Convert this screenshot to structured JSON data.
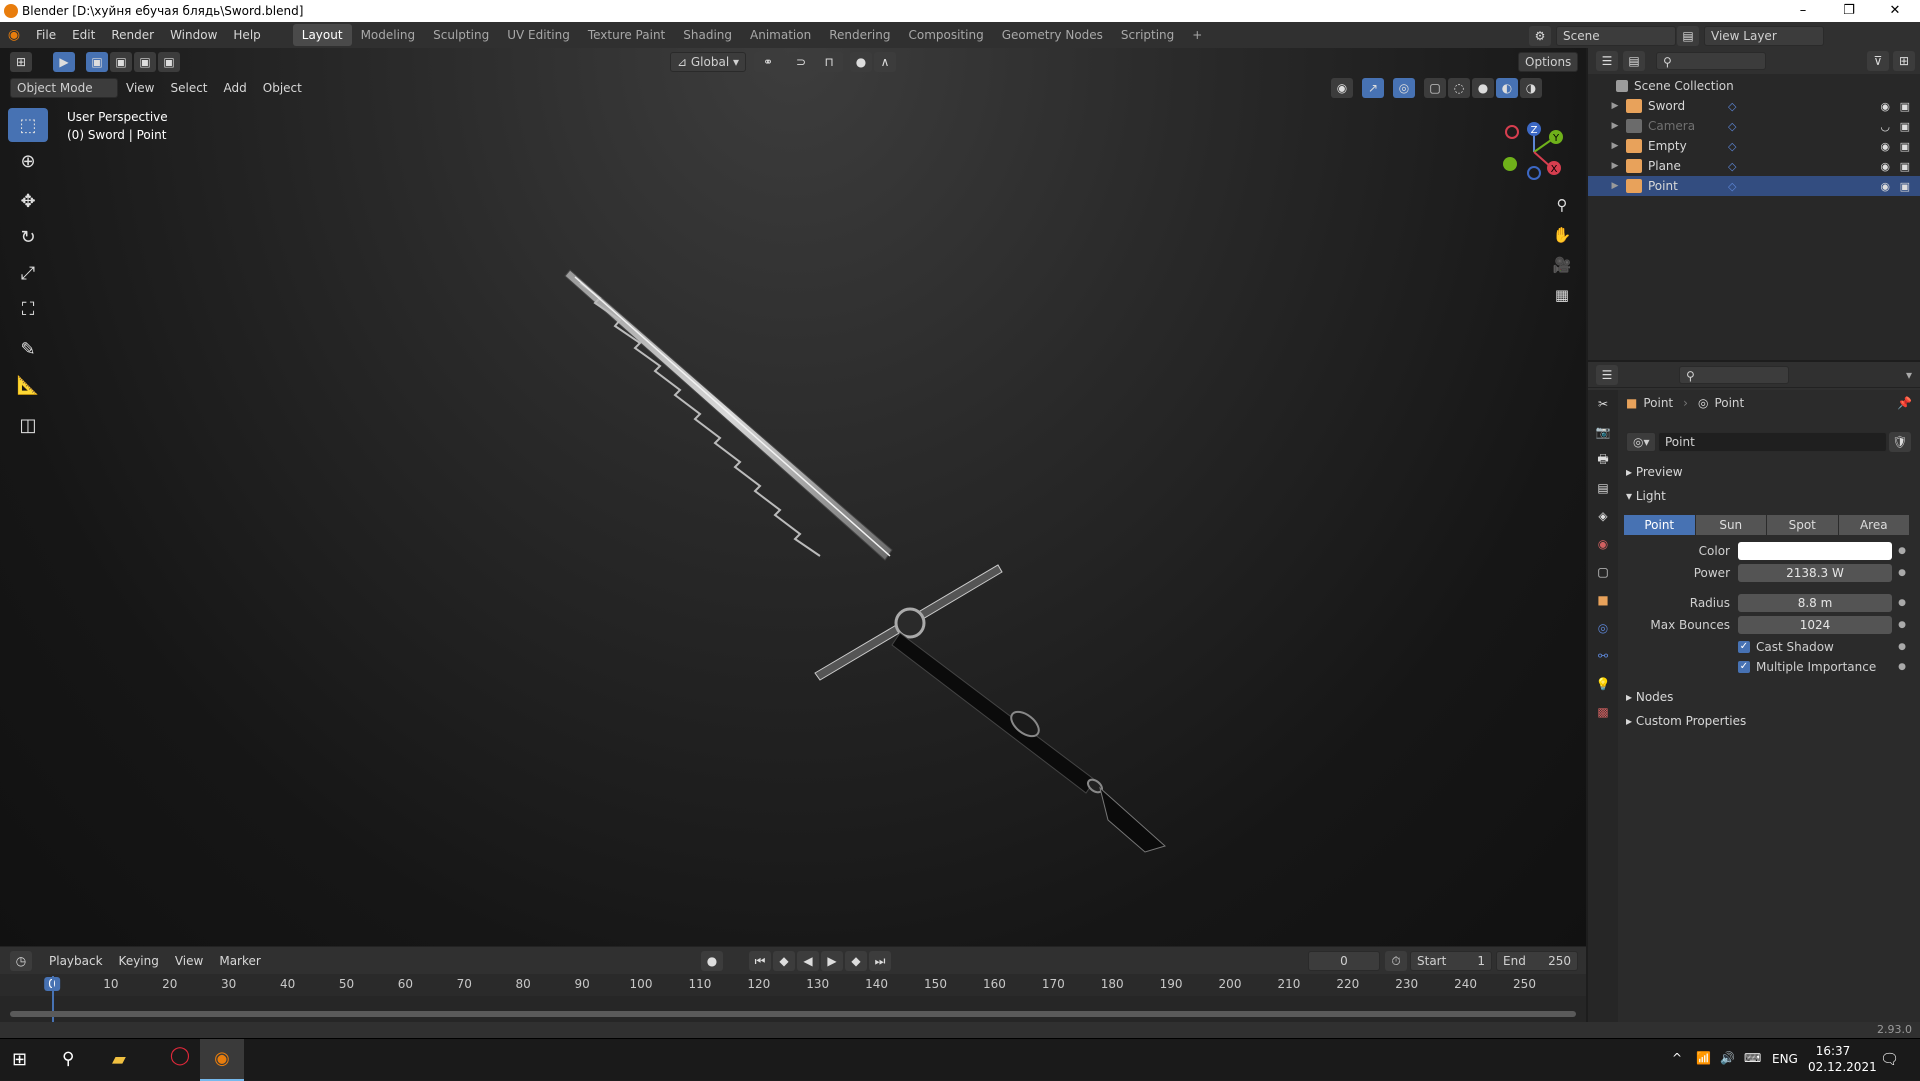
{
  "window": {
    "title": "Blender [D:\\хуйня ебучая блядь\\Sword.blend]",
    "minimize": "–",
    "maximize": "❐",
    "close": "✕"
  },
  "menus": [
    "File",
    "Edit",
    "Render",
    "Window",
    "Help"
  ],
  "workspaces": [
    "Layout",
    "Modeling",
    "Sculpting",
    "UV Editing",
    "Texture Paint",
    "Shading",
    "Animation",
    "Rendering",
    "Compositing",
    "Geometry Nodes",
    "Scripting"
  ],
  "active_workspace": "Layout",
  "add_workspace": "+",
  "scene": {
    "name": "Scene",
    "view_layer": "View Layer"
  },
  "viewport": {
    "transform_orientation": "Global",
    "options_label": "Options",
    "mode": "Object Mode",
    "menus": [
      "View",
      "Select",
      "Add",
      "Object"
    ],
    "info_line1": "User Perspective",
    "info_line2": "(0) Sword | Point",
    "gizmo": {
      "x": "X",
      "y": "Y",
      "z": "Z"
    }
  },
  "outliner": {
    "collection": "Scene Collection",
    "items": [
      {
        "name": "Sword",
        "color": "#e8a25b",
        "selected": false,
        "dim": false
      },
      {
        "name": "Camera",
        "color": "#6b6b6b",
        "selected": false,
        "dim": true
      },
      {
        "name": "Empty",
        "color": "#e8a25b",
        "selected": false,
        "dim": false
      },
      {
        "name": "Plane",
        "color": "#e8a25b",
        "selected": false,
        "dim": false
      },
      {
        "name": "Point",
        "color": "#e8a25b",
        "selected": true,
        "dim": false
      }
    ]
  },
  "properties": {
    "breadcrumb_object": "Point",
    "breadcrumb_data": "Point",
    "datablock": "Point",
    "sections": {
      "preview": "Preview",
      "light": "Light",
      "nodes": "Nodes",
      "custom": "Custom Properties"
    },
    "light_types": [
      "Point",
      "Sun",
      "Spot",
      "Area"
    ],
    "active_light_type": "Point",
    "color_label": "Color",
    "color_value": "#ffffff",
    "power_label": "Power",
    "power_value": "2138.3 W",
    "radius_label": "Radius",
    "radius_value": "8.8 m",
    "bounces_label": "Max Bounces",
    "bounces_value": "1024",
    "cast_shadow": "Cast Shadow",
    "multiple_importance": "Multiple Importance"
  },
  "timeline": {
    "menus": [
      "Playback",
      "Keying",
      "View",
      "Marker"
    ],
    "current_frame": "0",
    "start_label": "Start",
    "start_value": "1",
    "end_label": "End",
    "end_value": "250",
    "ticks": [
      "0",
      "10",
      "20",
      "30",
      "40",
      "50",
      "60",
      "70",
      "80",
      "90",
      "100",
      "110",
      "120",
      "130",
      "140",
      "150",
      "160",
      "170",
      "180",
      "190",
      "200",
      "210",
      "220",
      "230",
      "240",
      "250"
    ]
  },
  "status": {
    "version": "2.93.0"
  },
  "taskbar": {
    "lang": "ENG",
    "time": "16:37",
    "date": "02.12.2021"
  }
}
